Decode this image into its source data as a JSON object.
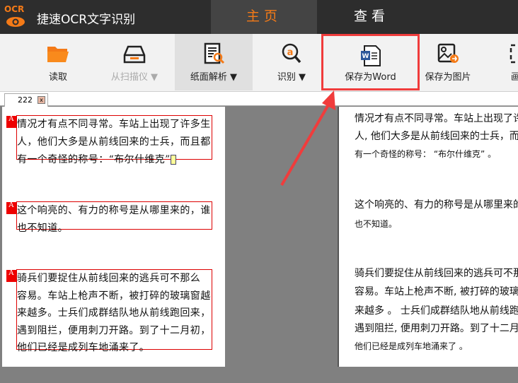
{
  "app": {
    "logo_text": "OCR",
    "title": "捷速OCR文字识别"
  },
  "tabs": [
    {
      "label": "主页",
      "active": true
    },
    {
      "label": "查看",
      "active": false
    }
  ],
  "toolbar": [
    {
      "label": "读取",
      "icon": "folder-icon"
    },
    {
      "label": "从扫描仪 ▼",
      "icon": "scanner-icon",
      "disabled": true
    },
    {
      "label": "纸面解析 ▼",
      "icon": "page-analysis-icon"
    },
    {
      "label": "识别 ▼",
      "icon": "recognize-icon"
    },
    {
      "label": "保存为Word",
      "icon": "word-icon",
      "highlighted": true
    },
    {
      "label": "保存为图片",
      "icon": "image-save-icon"
    },
    {
      "label": "画面",
      "icon": "screen-icon"
    }
  ],
  "doc_tab": {
    "label": "222",
    "close": "x"
  },
  "left_blocks": [
    {
      "marker": "A",
      "lines": [
        "情况才有点不同寻常。车站上出现了许多生",
        "人，他们大多是从前线回来的士兵，而且都",
        "有一个奇怪的称号：“布尔什维克”"
      ]
    },
    {
      "marker": "A",
      "lines": [
        "这个响亮的、有力的称号是从哪里来的，谁",
        "也不知道。"
      ]
    },
    {
      "marker": "A",
      "lines": [
        "骑兵们要捉住从前线回来的逃兵可不那么",
        "容易。车站上枪声不断，被打碎的玻璃窗越",
        "来越多。士兵们成群结队地从前线跑回来，",
        "遇到阻拦，便用刺刀开路。到了十二月初，",
        "他们已经是成列车地涌来了。"
      ]
    }
  ],
  "right_lines": [
    "情况才有点不同寻常。车站上出现了许多生",
    "人, 他们大多是从前线回来的士兵，而且都",
    "有一个奇怪的称号： “布尔什维克” 。",
    "这个响亮的、有力的称号是从哪里来的，谁",
    "也不知道。",
    "骑兵们要捉住从前线回来的逃兵可不那么",
    "容易。车站上枪声不断, 被打碎的玻璃窗越",
    "来越多 。 士兵们成群结队地从前线跑回来，",
    "遇到阻拦, 便用刺刀开路。到了十二月初，",
    "他们已经是成列车地涌来了 。"
  ],
  "colors": {
    "accent": "#f47a17",
    "highlight": "#f03c3c",
    "titlebar": "#2d2d2d"
  }
}
